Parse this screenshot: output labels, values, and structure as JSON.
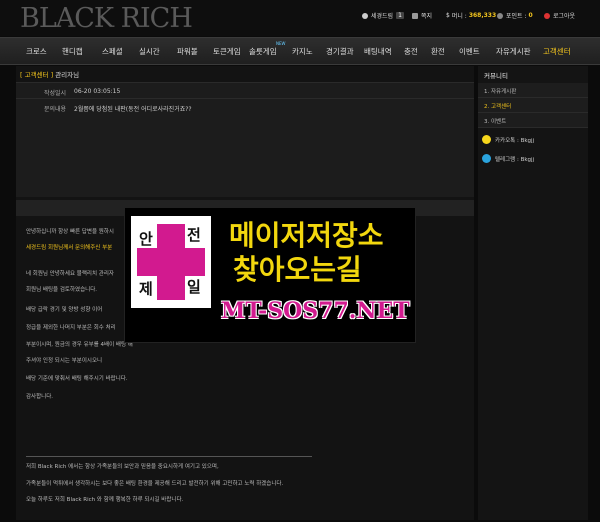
{
  "site": {
    "logo": "BLACK RICH"
  },
  "userbar": {
    "nickname": "세경드림",
    "level": "1",
    "messages": "쪽지",
    "money_label": "머니 :",
    "money": "368,333",
    "point_label": "포인트 :",
    "point": "0",
    "logout": "로그아웃"
  },
  "nav": {
    "items": [
      "크로스",
      "핸디캡",
      "스페셜",
      "실시간",
      "파워볼",
      "토큰게임",
      "솔룻게임",
      "카지노",
      "경기결과",
      "배팅내역",
      "충전",
      "환전",
      "이벤트",
      "자유게시판",
      "고객센터"
    ],
    "new_badge": "NEW"
  },
  "post": {
    "category": "[ 고객센터 ]",
    "title": "관리자님",
    "date_label": "작성일시",
    "date_value": "06-20 03:05:15",
    "content_label": "문의내용",
    "content_value": "2월쯤에 당첨된 내판(동전 어디로사라진거죠??"
  },
  "reply": {
    "lines": [
      "안녕하십니까 항상 빠른 답변을 원하시",
      "세경드림 회원님께서 문의해주신 부분",
      "",
      "네 회원님 안녕하세요 블랙리치 관리자",
      "회원님 배팅을 검토하였습니다.",
      "배당 급락 경기 및 양방 성향 이어",
      "정급을 제외한 나머지 부분은 회수 처리",
      "부분이시며, 원금의 경우 유부를 4배이 배팅 해",
      "주셔야 인정 되시는 부분이시오니",
      "배당 기준에 맞춰서 배팅 해주시기 바랍니다.",
      "감사합니다."
    ],
    "highlight_name": "세경드림",
    "footer": [
      "저희 Black Rich 에서는 항상 가족분들의 보안과 믿음을 중요시하게 여기고 있으며,",
      "가족분들이 먹튀에서 생각하시는 보다 좋은 배팅 환경을 제공해 드리고 발전하기 위해 고민하고 노력 하겠습니다.",
      "오늘 하루도 저희 Black Rich 와 함께 행복한 하루 되시길 바랍니다."
    ]
  },
  "sidebar": {
    "title": "커뮤니티",
    "items": [
      "1. 자유게시판",
      "2. 고객센터",
      "3. 이벤트"
    ],
    "kakao": "카카오톡 : Bkgjj",
    "telegram": "텔레그램 : Bkgjj"
  },
  "ad": {
    "badge_chars": [
      "안",
      "전",
      "제",
      "일"
    ],
    "line1": "메이저저장소",
    "line2": "찾아오는길",
    "url": "MT-SOS77.NET"
  },
  "colors": {
    "accent": "#f2c41d",
    "ad_magenta": "#d21a8f",
    "ad_yellow": "#f2d70e"
  }
}
